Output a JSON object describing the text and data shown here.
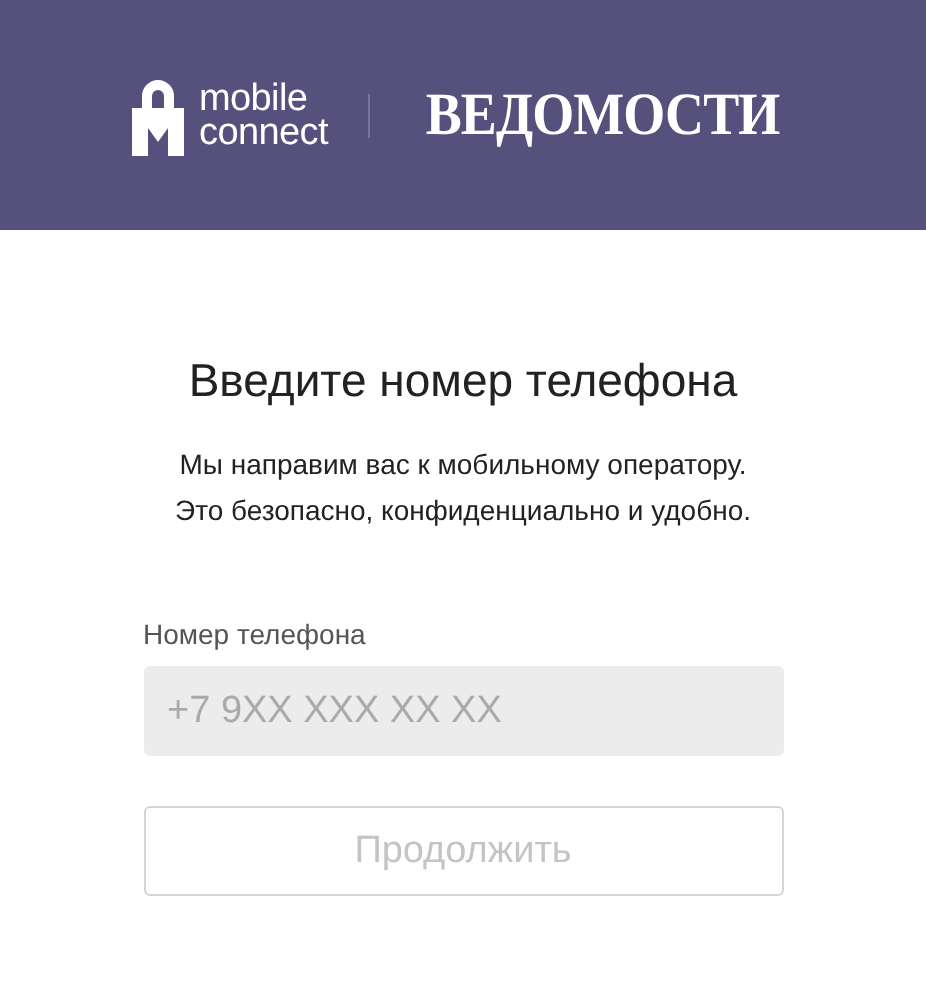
{
  "header": {
    "brand_lines": [
      "mobile",
      "connect"
    ],
    "partner": "ВЕДОМОСТИ"
  },
  "title": "Введите номер телефона",
  "subtitle_lines": [
    "Мы направим вас к мобильному оператору.",
    "Это безопасно, конфиденциально и удобно."
  ],
  "phone_field": {
    "label": "Номер телефона",
    "placeholder": "+7 9XX XXX XX XX"
  },
  "continue_button": {
    "label": "Продолжить",
    "disabled": true
  }
}
